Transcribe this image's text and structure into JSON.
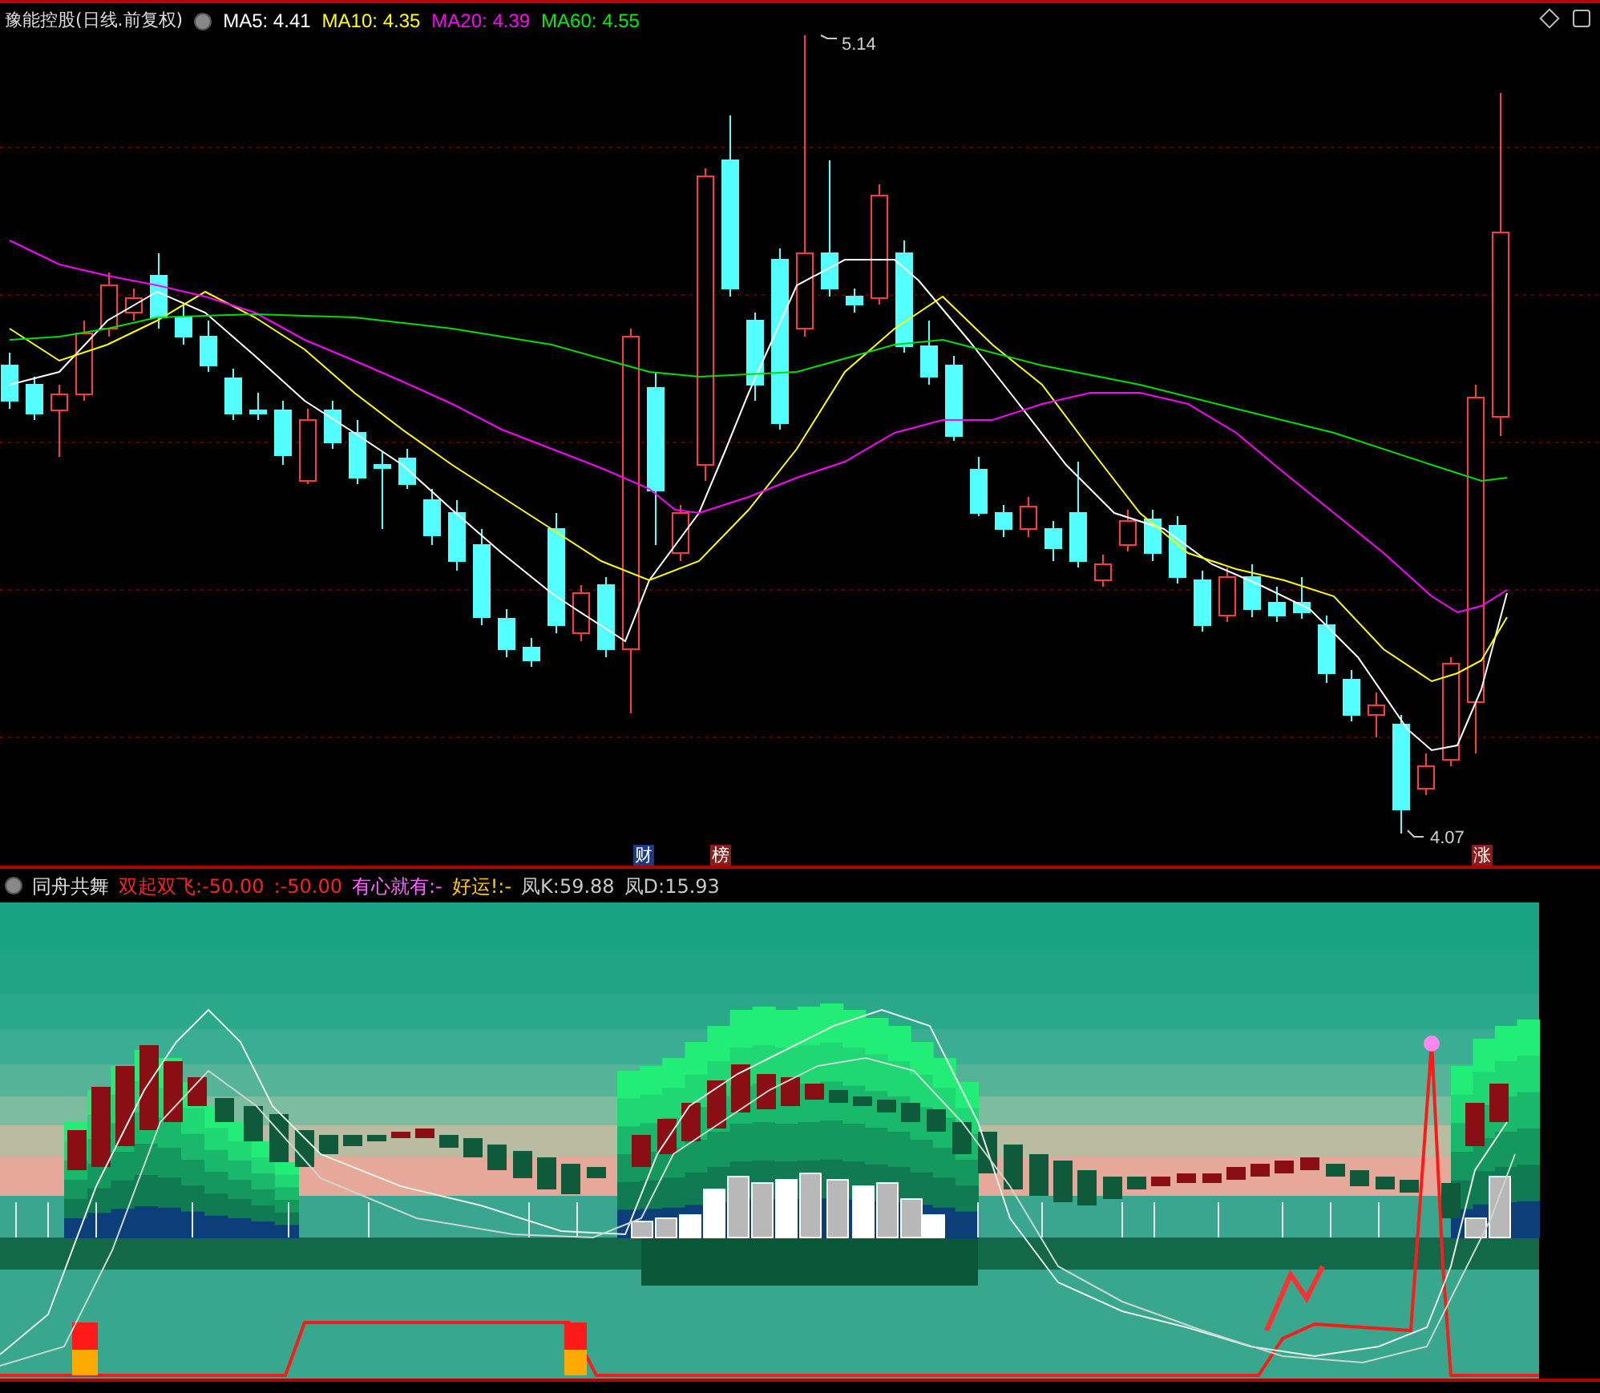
{
  "chart_header": {
    "title": "豫能控股(日线.前复权)",
    "moving_averages": [
      {
        "label": "MA5: 4.41",
        "color": "#ffffff"
      },
      {
        "label": "MA10: 4.35",
        "color": "#ffff00"
      },
      {
        "label": "MA20: 4.39",
        "color": "#ff00ff"
      },
      {
        "label": "MA60: 4.55",
        "color": "#00ee00"
      }
    ]
  },
  "high_label": "5.14",
  "low_label": "4.07",
  "event_markers": [
    {
      "text": "财",
      "color": "#1b3d80"
    },
    {
      "text": "榜",
      "color": "#8a1c1c"
    },
    {
      "text": "涨",
      "color": "#8a1c1c"
    }
  ],
  "indicator_header": {
    "title": "同舟共舞",
    "readings": [
      {
        "text": "双起双飞:-50.00",
        "color": "#ff2020"
      },
      {
        "text": ":-50.00",
        "color": "#ff2020"
      },
      {
        "text": "有心就有:-",
        "color": "#ff66ff"
      },
      {
        "text": "好运!:-",
        "color": "#ffcc00"
      },
      {
        "text": "凤K:59.88",
        "color": "#c8c8c8"
      },
      {
        "text": "凤D:15.93",
        "color": "#c8c8c8"
      }
    ]
  }
}
